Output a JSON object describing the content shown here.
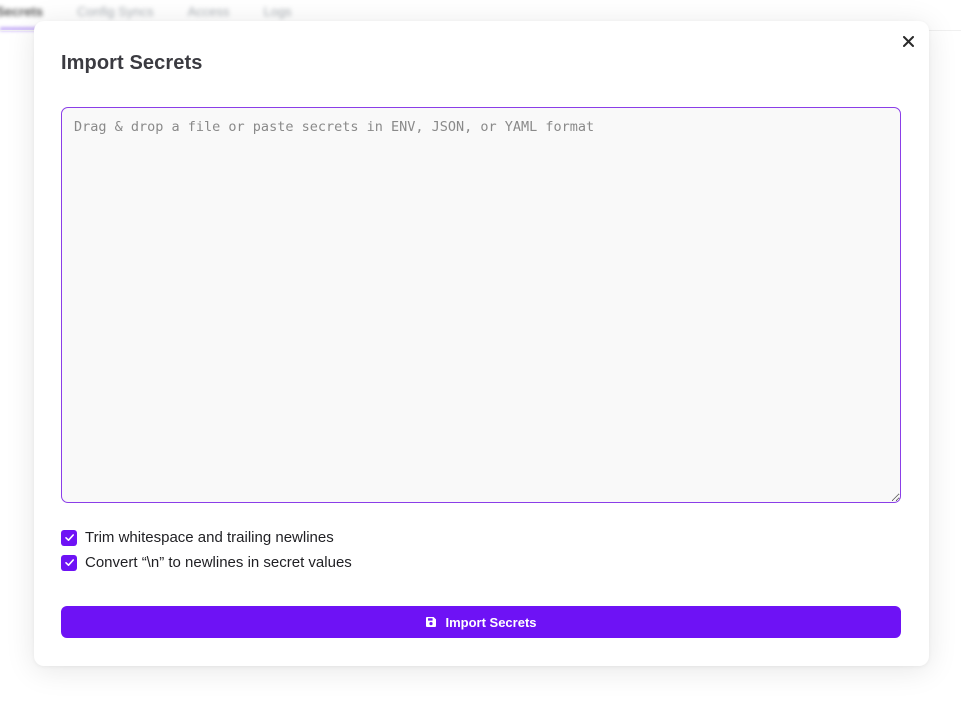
{
  "background": {
    "tabs": [
      {
        "label": "Secrets",
        "active": true
      },
      {
        "label": "Config Syncs",
        "active": false
      },
      {
        "label": "Access",
        "active": false
      },
      {
        "label": "Logs",
        "active": false
      }
    ]
  },
  "modal": {
    "title": "Import Secrets",
    "close_icon": "close-icon",
    "textarea": {
      "value": "",
      "placeholder": "Drag & drop a file or paste secrets in ENV, JSON, or YAML format"
    },
    "options": [
      {
        "label": "Trim whitespace and trailing newlines",
        "checked": true
      },
      {
        "label": "Convert “\\n” to newlines in secret values",
        "checked": true
      }
    ],
    "submit": {
      "label": "Import Secrets",
      "icon": "save-icon"
    }
  },
  "colors": {
    "accent": "#6e12f5",
    "focus_border": "#8b3ee8",
    "title": "#3b3b41"
  }
}
